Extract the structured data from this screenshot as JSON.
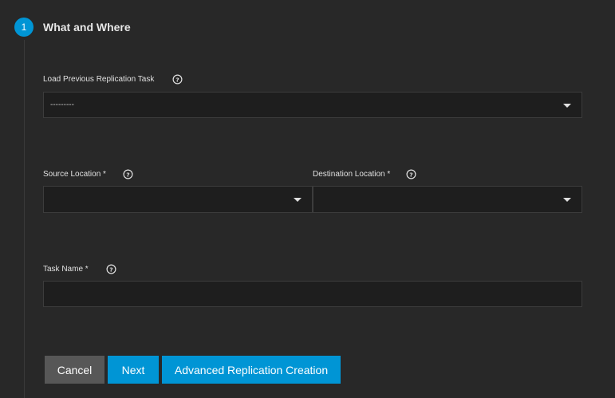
{
  "step": {
    "number": "1",
    "title": "What and Where"
  },
  "fields": {
    "load_previous": {
      "label": "Load Previous Replication Task",
      "value": "---------"
    },
    "source_location": {
      "label": "Source Location *",
      "value": ""
    },
    "destination_location": {
      "label": "Destination Location *",
      "value": ""
    },
    "task_name": {
      "label": "Task Name *",
      "value": ""
    }
  },
  "buttons": {
    "cancel": "Cancel",
    "next": "Next",
    "advanced": "Advanced Replication Creation"
  },
  "colors": {
    "accent": "#0095d5",
    "background": "#282828",
    "field_background": "#1e1e1e",
    "cancel_button": "#575757"
  },
  "icons": {
    "help": "help-circle-icon",
    "dropdown": "dropdown-arrow-icon"
  }
}
